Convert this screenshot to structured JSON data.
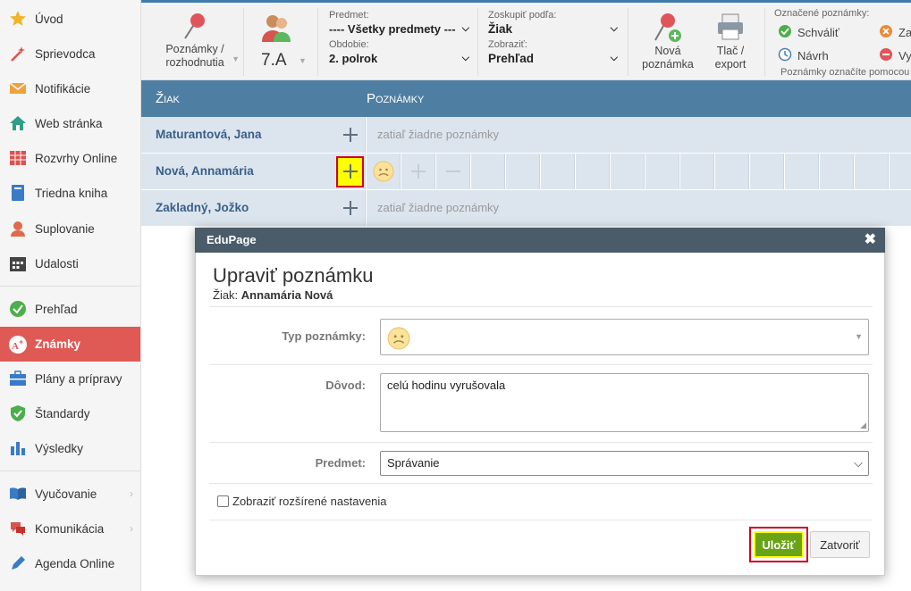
{
  "sidebar": {
    "items": [
      {
        "label": "Úvod",
        "icon": "star-icon"
      },
      {
        "label": "Sprievodca",
        "icon": "wand-icon"
      },
      {
        "label": "Notifikácie",
        "icon": "envelope-icon"
      },
      {
        "label": "Web stránka",
        "icon": "house-icon"
      },
      {
        "label": "Rozvrhy Online",
        "icon": "timetable-icon"
      },
      {
        "label": "Triedna kniha",
        "icon": "book-icon"
      },
      {
        "label": "Suplovanie",
        "icon": "person-icon"
      },
      {
        "label": "Udalosti",
        "icon": "calendar-icon"
      },
      {
        "label": "Prehľad",
        "icon": "check-circle-icon"
      },
      {
        "label": "Známky",
        "icon": "grade-icon"
      },
      {
        "label": "Plány a prípravy",
        "icon": "briefcase-icon"
      },
      {
        "label": "Štandardy",
        "icon": "shield-icon"
      },
      {
        "label": "Výsledky",
        "icon": "bar-chart-icon"
      },
      {
        "label": "Vyučovanie",
        "icon": "open-book-icon"
      },
      {
        "label": "Komunikácia",
        "icon": "chat-icon"
      },
      {
        "label": "Agenda Online",
        "icon": "pen-icon"
      }
    ]
  },
  "toolbar": {
    "notes_btn": "Poznámky /",
    "notes_btn2": "rozhodnutia",
    "class_label": "7.A",
    "subject_caption": "Predmet:",
    "subject_value": "---- Všetky predmety ---",
    "period_caption": "Obdobie:",
    "period_value": "2. polrok",
    "group_caption": "Zoskupiť podľa:",
    "group_value": "Žiak",
    "show_caption": "Zobraziť:",
    "show_value": "Prehľad",
    "new_note_1": "Nová",
    "new_note_2": "poznámka",
    "print_1": "Tlač /",
    "print_2": "export",
    "marked_caption": "Označené poznámky:",
    "approve": "Schváliť",
    "draft": "Návrh",
    "reject": "Za",
    "delete": "Vy",
    "hint": "Poznámky označíte pomocou"
  },
  "table": {
    "col_student": "Žiak",
    "col_notes": "Poznámky",
    "rows": [
      {
        "name": "Maturantová, Jana",
        "notes": "zatiaľ žiadne poznámky"
      },
      {
        "name": "Nová, Annamária",
        "notes": ""
      },
      {
        "name": "Zakladný, Jožko",
        "notes": "zatiaľ žiadne poznámky"
      }
    ]
  },
  "modal": {
    "header": "EduPage",
    "title": "Upraviť poznámku",
    "student_prefix": "Žiak:",
    "student_name": "Annamária Nová",
    "type_label": "Typ poznámky:",
    "reason_label": "Dôvod:",
    "reason_value": "celú hodinu vyrušovala",
    "subject_label": "Predmet:",
    "subject_value": "Správanie",
    "advanced_label": "Zobraziť rozšírené nastavenia",
    "save": "Uložiť",
    "close": "Zatvoriť"
  },
  "colors": {
    "accent": "#4f7ea3",
    "active": "#e05a55",
    "save": "#6aa316",
    "highlight": "#ffff00"
  }
}
